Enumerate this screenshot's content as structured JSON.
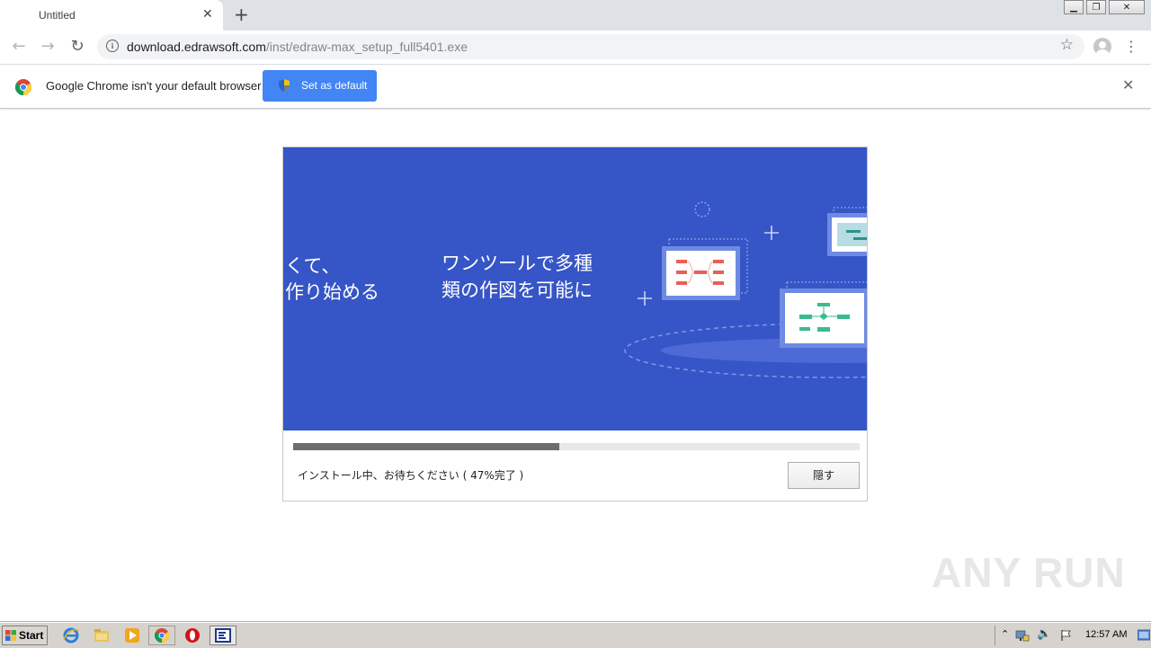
{
  "browser": {
    "tab_title": "Untitled",
    "tab_close": "✕",
    "new_tab": "+",
    "window_controls": {
      "minimize": "▁",
      "restore": "❐",
      "close": "✕"
    },
    "nav": {
      "back": "←",
      "forward": "→",
      "reload": "↻"
    },
    "address": {
      "host": "download.edrawsoft.com",
      "path": "/inst/edraw-max_setup_full5401.exe"
    },
    "bookmark_star": "☆",
    "menu": "⋮"
  },
  "infobar": {
    "message": "Google Chrome isn't your default browser",
    "button": "Set as default",
    "close": "✕"
  },
  "installer": {
    "banner_left": "くて、\n作り始める",
    "banner_right_line1": "ワンツールで多種",
    "banner_right_line2": "類の作図を可能に",
    "progress": 0.47,
    "status": "インストール中、お待ちください ( 47%完了 )",
    "hide_button": "隠す",
    "colors": {
      "banner": "#3655c6",
      "progress_fill": "#6d6d6d",
      "progress_track": "#e8e8e8"
    }
  },
  "watermark": "ANY RUN",
  "taskbar": {
    "start": "Start",
    "pinned": [
      "ie-icon",
      "folder-icon",
      "media-player-icon",
      "chrome-icon",
      "opera-icon"
    ],
    "active_app": "edraw-installer-icon",
    "clock": "12:57 AM"
  }
}
